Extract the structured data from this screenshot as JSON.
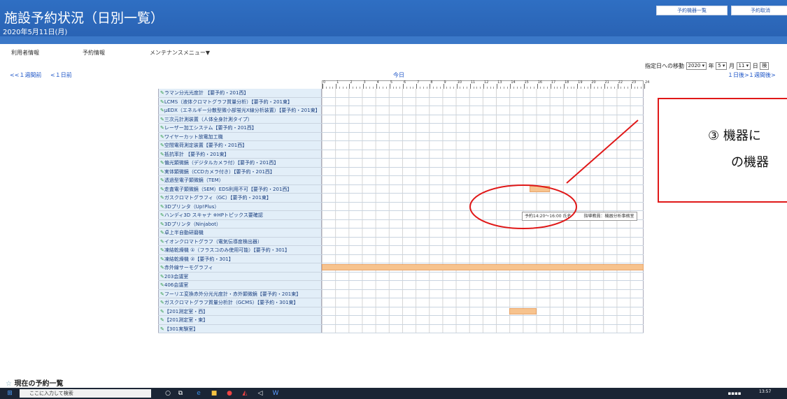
{
  "header": {
    "title": "施設予約状況（日別一覧）",
    "date": "2020年5月11日(月)",
    "buttons": [
      "予約機器一覧",
      "予約取消"
    ]
  },
  "nav": [
    "利用者情報",
    "予約情報",
    "メンテナンスメニュー▼"
  ],
  "navigation": {
    "prev_week": "<<１週間前",
    "prev_day": "<１日前",
    "today": "今日",
    "next_day": "１日後>",
    "next_week": "１週間後>",
    "jump_label": "指定日への移動",
    "year_value": "2020",
    "year_suffix": "年",
    "month_value": "5",
    "month_suffix": "月",
    "day_value": "11",
    "day_suffix": "日",
    "search_label": "検"
  },
  "ruler_hours": [
    "0",
    "1",
    "2",
    "3",
    "4",
    "5",
    "6",
    "7",
    "8",
    "9",
    "10",
    "11",
    "12",
    "13",
    "14",
    "15",
    "16",
    "17",
    "18",
    "19",
    "20",
    "21",
    "22",
    "23",
    "24"
  ],
  "equipment": [
    {
      "name": "ラマン分光光度計 【要予約・201西】"
    },
    {
      "name": "LCMS（液体クロマトグラフ質量分析）【要予約・201東】"
    },
    {
      "name": "μEDX（エネルギー分散型微小部蛍光X線分析装置）【要予約・201東】"
    },
    {
      "name": "三次元計測装置（人体全身計測タイプ）"
    },
    {
      "name": "レーザー加工システム【要予約・201西】"
    },
    {
      "name": "ワイヤーカット放電加工機"
    },
    {
      "name": "空間電荷測定装置【要予約・201西】"
    },
    {
      "name": "抵抗率計 【要予約・201東】"
    },
    {
      "name": "偏光顕微鏡（デジタルカメラ付）【要予約・201西】"
    },
    {
      "name": "実体顕微鏡（CCDカメラ付き）【要予約・201西】"
    },
    {
      "name": "透過型電子顕微鏡（TEM）"
    },
    {
      "name": "走査電子顕微鏡（SEM）EDS利用不可【要予約・201西】",
      "bar": [
        15.5,
        17
      ]
    },
    {
      "name": "ガスクロマトグラフィ（GC）【要予約・201東】"
    },
    {
      "name": "3Dプリンタ（Up!Plus）"
    },
    {
      "name": "ハンディ3D スキャナ ※HPトピックス要確認"
    },
    {
      "name": "3Dプリンタ（Ninjabot）"
    },
    {
      "name": "卓上半自動研磨機"
    },
    {
      "name": "イオンクロマトグラフ（電気伝導度検出器）"
    },
    {
      "name": "凍結乾燥機 ①（フラスコのみ使用可能）【要予約・301】"
    },
    {
      "name": "凍結乾燥機 ②【要予約・301】"
    },
    {
      "name": "赤外線サーモグラフィ",
      "bar": [
        0,
        24
      ]
    },
    {
      "name": "203会議室"
    },
    {
      "name": "406会議室"
    },
    {
      "name": "フーリエ変換赤外分光光度計・赤外顕微鏡【要予約・201東】"
    },
    {
      "name": "ガスクロマトグラフ質量分析計（GCMS）【要予約・301東】"
    },
    {
      "name": "【201測定室・西】",
      "bar": [
        14,
        16
      ]
    },
    {
      "name": "【201測定室・東】"
    },
    {
      "name": "【301実験室】"
    }
  ],
  "tooltip": "予約14:20〜16:00 氏名　　　指導教員：機器分析事務室",
  "callout": {
    "line1": "③ 機器に",
    "line2": "の機器"
  },
  "current_list_title": "現在の予約一覧",
  "taskbar": {
    "search_placeholder": "ここに入力して検索",
    "clock": "13:57"
  }
}
